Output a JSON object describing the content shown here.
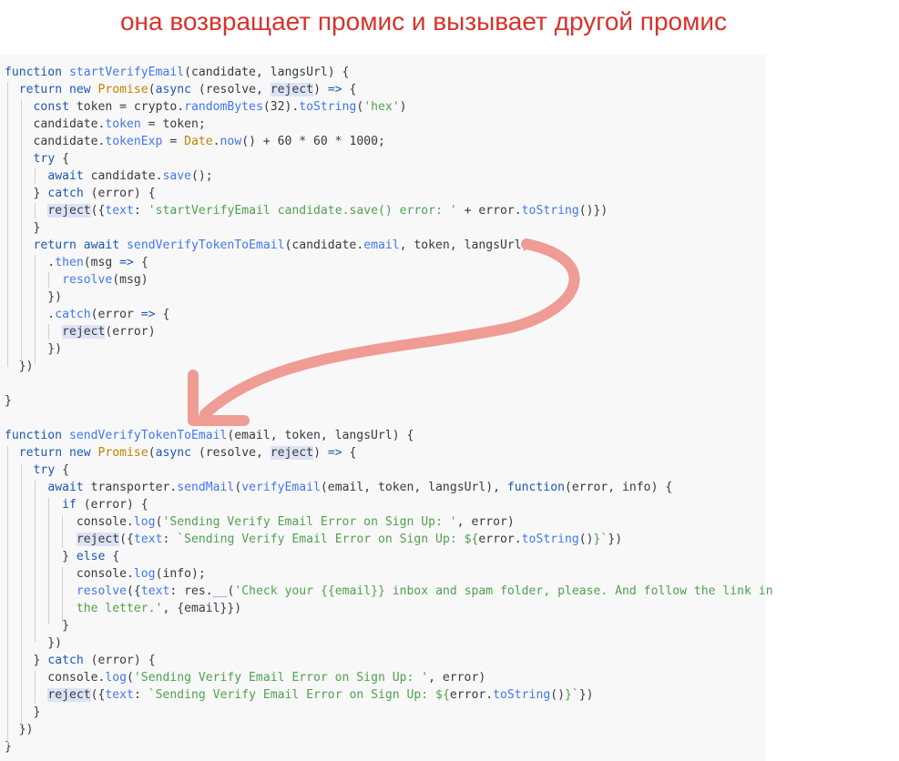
{
  "title": "она возвращает промис и вызывает другой промис",
  "colors": {
    "title": "#d8322c",
    "arrow": "#ef9c95",
    "editor_bg": "#f8f8f8"
  },
  "annotation": {
    "arrow": "curved-arrow"
  },
  "lines": [
    [
      [
        "function ",
        "kw"
      ],
      [
        "startVerifyEmail",
        "prop"
      ],
      [
        "(candidate, langsUrl) {",
        ""
      ]
    ],
    [
      [
        "  ",
        ""
      ],
      [
        "return ",
        "kw"
      ],
      [
        "new ",
        "kw"
      ],
      [
        "Promise",
        "cls"
      ],
      [
        "(",
        ""
      ],
      [
        "async ",
        "kw"
      ],
      [
        "(resolve, ",
        ""
      ],
      [
        "reject",
        "hl"
      ],
      [
        ") ",
        ""
      ],
      [
        "=>",
        "op"
      ],
      [
        " {",
        ""
      ]
    ],
    [
      [
        "    ",
        ""
      ],
      [
        "const ",
        "kw"
      ],
      [
        "token = crypto.",
        ""
      ],
      [
        "randomBytes",
        "prop"
      ],
      [
        "(32).",
        ""
      ],
      [
        "toString",
        "prop"
      ],
      [
        "(",
        ""
      ],
      [
        "'hex'",
        "str"
      ],
      [
        ")",
        ""
      ]
    ],
    [
      [
        "    candidate.",
        ""
      ],
      [
        "token",
        "prop"
      ],
      [
        " = token;",
        ""
      ]
    ],
    [
      [
        "    candidate.",
        ""
      ],
      [
        "tokenExp",
        "prop"
      ],
      [
        " = ",
        ""
      ],
      [
        "Date",
        "cls"
      ],
      [
        ".",
        ""
      ],
      [
        "now",
        "prop"
      ],
      [
        "() + 60 * 60 * 1000;",
        ""
      ]
    ],
    [
      [
        "    ",
        ""
      ],
      [
        "try",
        "kw"
      ],
      [
        " {",
        ""
      ]
    ],
    [
      [
        "      ",
        ""
      ],
      [
        "await ",
        "kw"
      ],
      [
        "candidate.",
        ""
      ],
      [
        "save",
        "prop"
      ],
      [
        "();",
        ""
      ]
    ],
    [
      [
        "    } ",
        ""
      ],
      [
        "catch ",
        "kw"
      ],
      [
        "(error) {",
        ""
      ]
    ],
    [
      [
        "      ",
        ""
      ],
      [
        "reject",
        "hl"
      ],
      [
        "({",
        ""
      ],
      [
        "text",
        "prop"
      ],
      [
        ": ",
        ""
      ],
      [
        "'startVerifyEmail candidate.save() error: '",
        "str"
      ],
      [
        " + error.",
        ""
      ],
      [
        "toString",
        "prop"
      ],
      [
        "()})",
        ""
      ]
    ],
    [
      [
        "    }",
        ""
      ]
    ],
    [
      [
        "    ",
        ""
      ],
      [
        "return ",
        "kw"
      ],
      [
        "await ",
        "kw"
      ],
      [
        "sendVerifyTokenToEmail",
        "prop"
      ],
      [
        "(candidate.",
        ""
      ],
      [
        "email",
        "prop"
      ],
      [
        ", token, langsUrl)",
        ""
      ]
    ],
    [
      [
        "      .",
        ""
      ],
      [
        "then",
        "prop"
      ],
      [
        "(msg ",
        ""
      ],
      [
        "=>",
        "op"
      ],
      [
        " {",
        ""
      ]
    ],
    [
      [
        "        ",
        ""
      ],
      [
        "resolve",
        "prop"
      ],
      [
        "(msg)",
        ""
      ]
    ],
    [
      [
        "      })",
        ""
      ]
    ],
    [
      [
        "      .",
        ""
      ],
      [
        "catch",
        "prop"
      ],
      [
        "(error ",
        ""
      ],
      [
        "=>",
        "op"
      ],
      [
        " {",
        ""
      ]
    ],
    [
      [
        "        ",
        ""
      ],
      [
        "reject",
        "hl"
      ],
      [
        "(error)",
        ""
      ]
    ],
    [
      [
        "      })",
        ""
      ]
    ],
    [
      [
        "  })",
        ""
      ]
    ],
    [
      [
        "",
        ""
      ]
    ],
    [
      [
        "}",
        ""
      ]
    ],
    [
      [
        "",
        ""
      ]
    ],
    [
      [
        "function ",
        "kw"
      ],
      [
        "sendVerifyTokenToEmail",
        "prop"
      ],
      [
        "(email, token, langsUrl) {",
        ""
      ]
    ],
    [
      [
        "  ",
        ""
      ],
      [
        "return ",
        "kw"
      ],
      [
        "new ",
        "kw"
      ],
      [
        "Promise",
        "cls"
      ],
      [
        "(",
        ""
      ],
      [
        "async ",
        "kw"
      ],
      [
        "(resolve, ",
        ""
      ],
      [
        "reject",
        "hl"
      ],
      [
        ") ",
        ""
      ],
      [
        "=>",
        "op"
      ],
      [
        " {",
        ""
      ]
    ],
    [
      [
        "    ",
        ""
      ],
      [
        "try",
        "kw"
      ],
      [
        " {",
        ""
      ]
    ],
    [
      [
        "      ",
        ""
      ],
      [
        "await ",
        "kw"
      ],
      [
        "transporter.",
        ""
      ],
      [
        "sendMail",
        "prop"
      ],
      [
        "(",
        ""
      ],
      [
        "verifyEmail",
        "prop"
      ],
      [
        "(email, token, langsUrl), ",
        ""
      ],
      [
        "function",
        "kw"
      ],
      [
        "(error, info) {",
        ""
      ]
    ],
    [
      [
        "        ",
        ""
      ],
      [
        "if ",
        "kw"
      ],
      [
        "(error) {",
        ""
      ]
    ],
    [
      [
        "          console.",
        ""
      ],
      [
        "log",
        "prop"
      ],
      [
        "(",
        ""
      ],
      [
        "'Sending Verify Email Error on Sign Up: '",
        "str"
      ],
      [
        ", error)",
        ""
      ]
    ],
    [
      [
        "          ",
        ""
      ],
      [
        "reject",
        "hl"
      ],
      [
        "({",
        ""
      ],
      [
        "text",
        "prop"
      ],
      [
        ": ",
        ""
      ],
      [
        "`Sending Verify Email Error on Sign Up: ${",
        "str"
      ],
      [
        "error.",
        ""
      ],
      [
        "toString",
        "prop"
      ],
      [
        "()",
        ""
      ],
      [
        "}`",
        "str"
      ],
      [
        "})",
        ""
      ]
    ],
    [
      [
        "        } ",
        ""
      ],
      [
        "else ",
        "kw"
      ],
      [
        "{",
        ""
      ]
    ],
    [
      [
        "          console.",
        ""
      ],
      [
        "log",
        "prop"
      ],
      [
        "(info);",
        ""
      ]
    ],
    [
      [
        "          ",
        ""
      ],
      [
        "resolve",
        "prop"
      ],
      [
        "({",
        ""
      ],
      [
        "text",
        "prop"
      ],
      [
        ": res.",
        ""
      ],
      [
        "__",
        "prop"
      ],
      [
        "(",
        ""
      ],
      [
        "'Check your {{email}} inbox and spam folder, please. And follow the link in",
        "str"
      ]
    ],
    [
      [
        "          ",
        ""
      ],
      [
        "the letter.'",
        "str"
      ],
      [
        ", {email}})",
        ""
      ]
    ],
    [
      [
        "        }",
        ""
      ]
    ],
    [
      [
        "      })",
        ""
      ]
    ],
    [
      [
        "    } ",
        ""
      ],
      [
        "catch ",
        "kw"
      ],
      [
        "(error) {",
        ""
      ]
    ],
    [
      [
        "      console.",
        ""
      ],
      [
        "log",
        "prop"
      ],
      [
        "(",
        ""
      ],
      [
        "'Sending Verify Email Error on Sign Up: '",
        "str"
      ],
      [
        ", error)",
        ""
      ]
    ],
    [
      [
        "      ",
        ""
      ],
      [
        "reject",
        "hl"
      ],
      [
        "({",
        ""
      ],
      [
        "text",
        "prop"
      ],
      [
        ": ",
        ""
      ],
      [
        "`Sending Verify Email Error on Sign Up: ${",
        "str"
      ],
      [
        "error.",
        ""
      ],
      [
        "toString",
        "prop"
      ],
      [
        "()",
        ""
      ],
      [
        "}`",
        "str"
      ],
      [
        "})",
        ""
      ]
    ],
    [
      [
        "    }",
        ""
      ]
    ],
    [
      [
        "  })",
        ""
      ]
    ],
    [
      [
        "}",
        ""
      ]
    ]
  ]
}
